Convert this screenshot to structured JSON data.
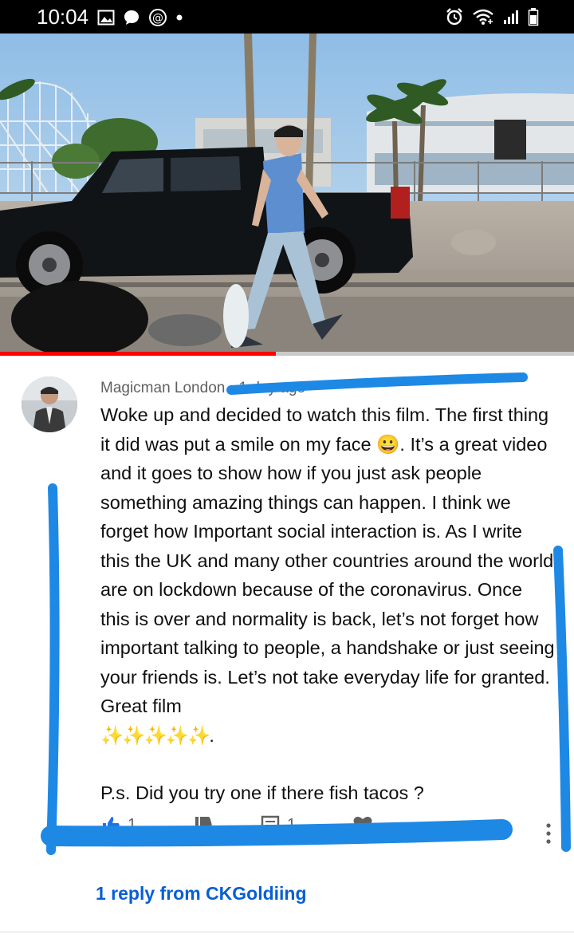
{
  "status_bar": {
    "time": "10:04",
    "left_icons": [
      "gallery-icon",
      "chat-bubble-icon",
      "at-sign-icon",
      "dot-icon"
    ],
    "right_icons": [
      "alarm-icon",
      "wifi-icon",
      "signal-icon",
      "battery-icon"
    ]
  },
  "video": {
    "progress_fraction": 0.48
  },
  "comment": {
    "author": "Magicman London",
    "separator": "•",
    "time": "1 day ago",
    "paragraphs": [
      "Woke up and decided to watch this film. The first thing it did was put a smile on my face 😀. It’s a great video and it goes to show how if you just ask people something amazing things can happen. I think we forget how Important social interaction is. As I write this the UK and many other countries around the world are on lockdown because of the coronavirus. Once this is over and normality is back, let’s not forget how important talking to people, a handshake or just seeing your friends is. Let’s not take everyday life for granted. Great film",
      "P.s. Did you try one if there fish tacos ?"
    ],
    "stars": "✨✨✨✨✨",
    "stars_tail": ".",
    "like_count": "1",
    "reply_count": "1",
    "replies_link": "1 reply from CKGoldiing"
  },
  "colors": {
    "link": "#065fd4",
    "progress": "#ff0000",
    "marker": "#1e88e5"
  }
}
